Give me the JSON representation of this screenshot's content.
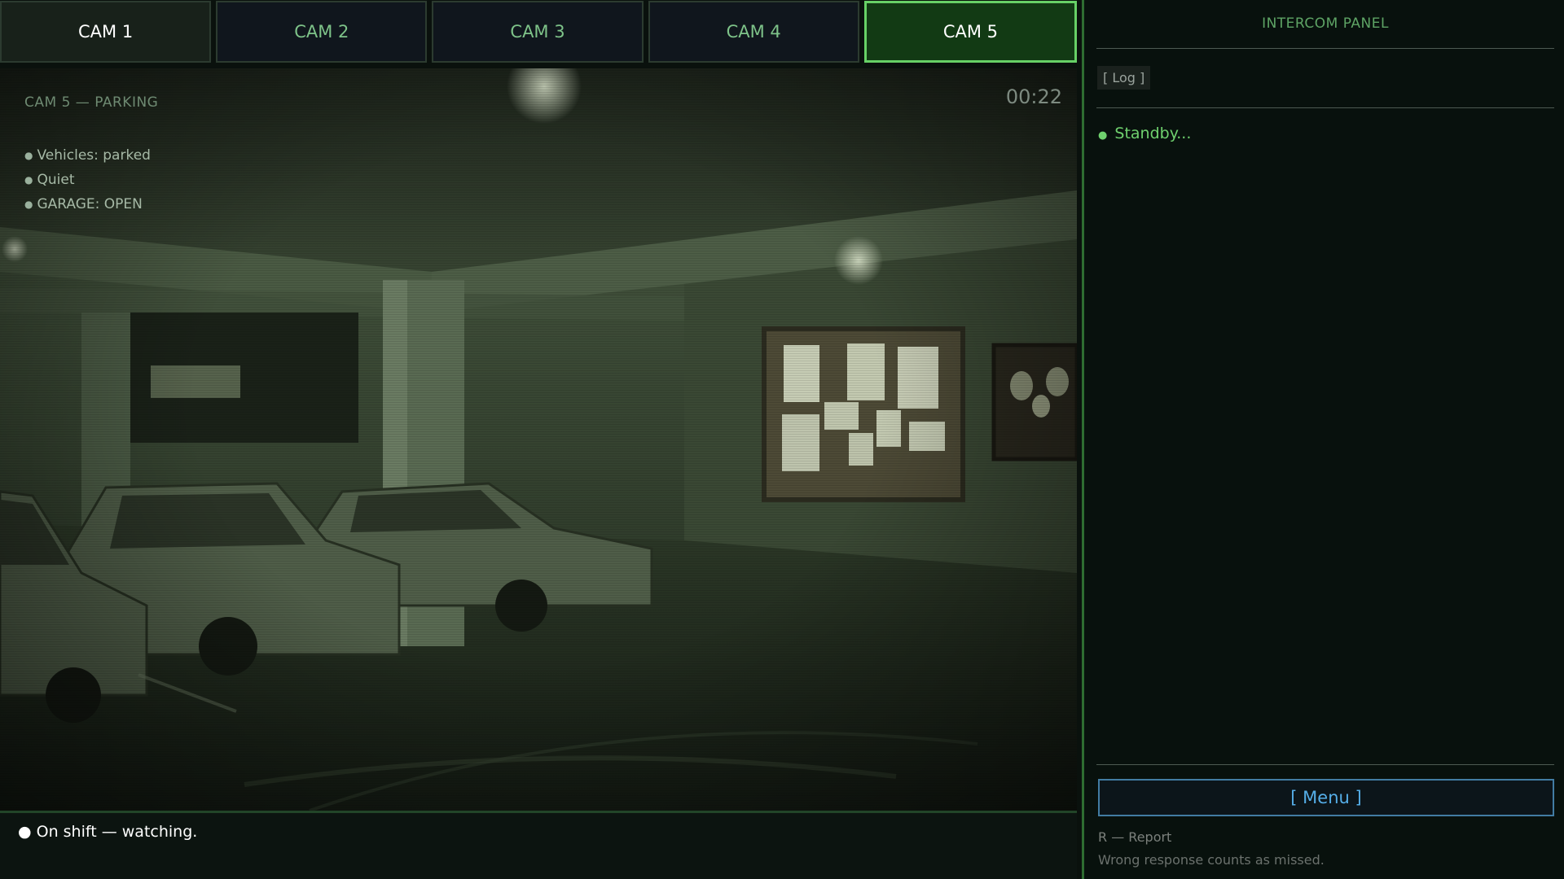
{
  "tabs": [
    {
      "label": "CAM 1"
    },
    {
      "label": "CAM 2"
    },
    {
      "label": "CAM 3"
    },
    {
      "label": "CAM 4"
    },
    {
      "label": "CAM 5"
    }
  ],
  "active_tab": "CAM 5",
  "feed": {
    "title": "CAM 5 — PARKING",
    "time": "00:22",
    "status": [
      "Vehicles: parked",
      "Quiet",
      "GARAGE: OPEN"
    ]
  },
  "bottom_bar": {
    "status": "● On shift — watching."
  },
  "panel": {
    "title": "INTERCOM PANEL",
    "log_button": "[ Log ]",
    "standby": "Standby...",
    "menu_button": "[ Menu ]",
    "hint_report": "R — Report",
    "hint_missed": "Wrong response counts as missed."
  },
  "colors": {
    "accent_green": "#67d166",
    "menu_blue": "#55aee8",
    "panel_bg": "#08110d"
  },
  "icons": {
    "status_dot": "bullet-dot-icon"
  }
}
